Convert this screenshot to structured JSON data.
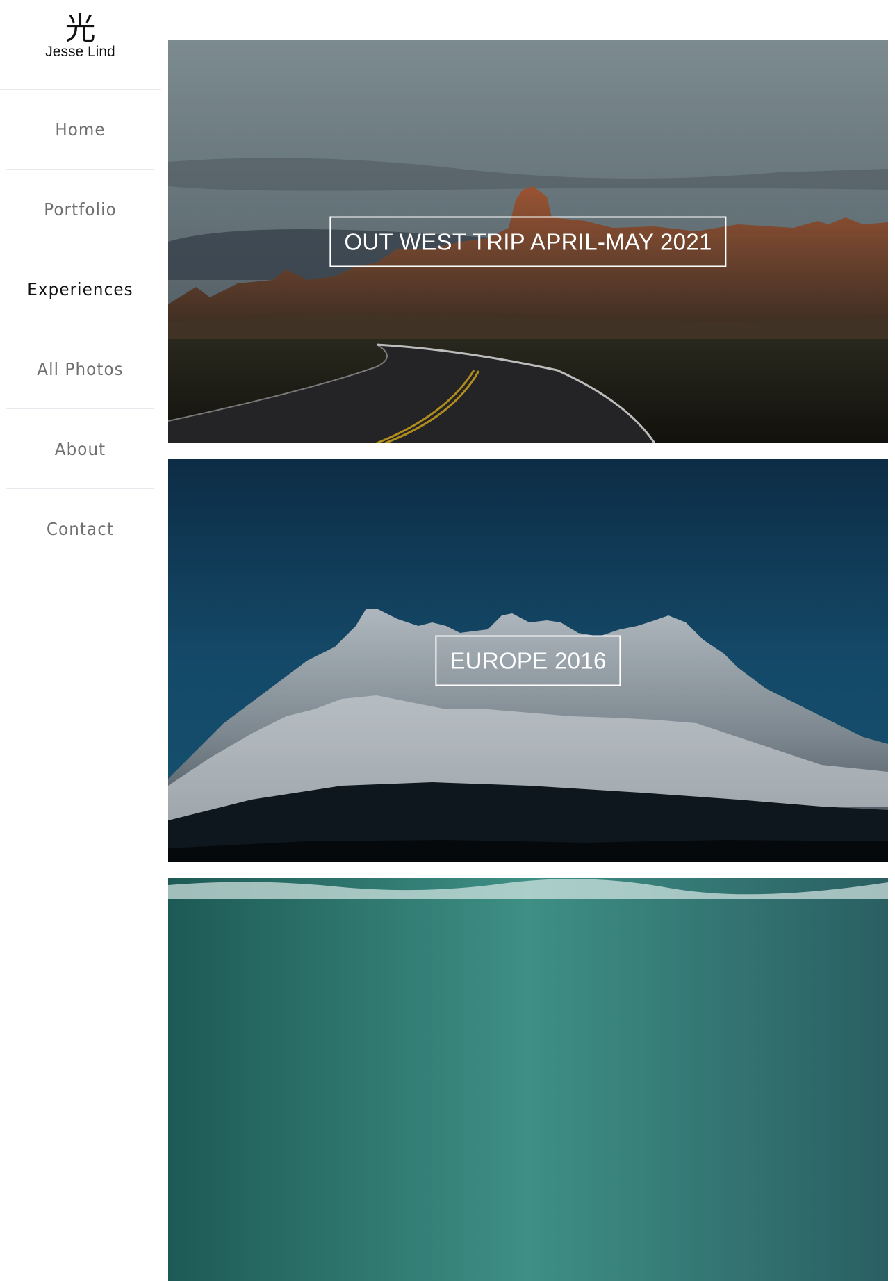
{
  "logo": {
    "mark": "光",
    "name": "Jesse Lind"
  },
  "nav": {
    "items": [
      {
        "label": "Home",
        "active": false
      },
      {
        "label": "Portfolio",
        "active": false
      },
      {
        "label": "Experiences",
        "active": true
      },
      {
        "label": "All Photos",
        "active": false
      },
      {
        "label": "About",
        "active": false
      },
      {
        "label": "Contact",
        "active": false
      }
    ]
  },
  "experiences": [
    {
      "title": "OUT WEST TRIP APRIL-MAY 2021",
      "image": "badlands-road-photo"
    },
    {
      "title": "EUROPE 2016",
      "image": "snowy-mountain-photo"
    },
    {
      "title": "",
      "image": "ocean-wave-photo"
    }
  ]
}
